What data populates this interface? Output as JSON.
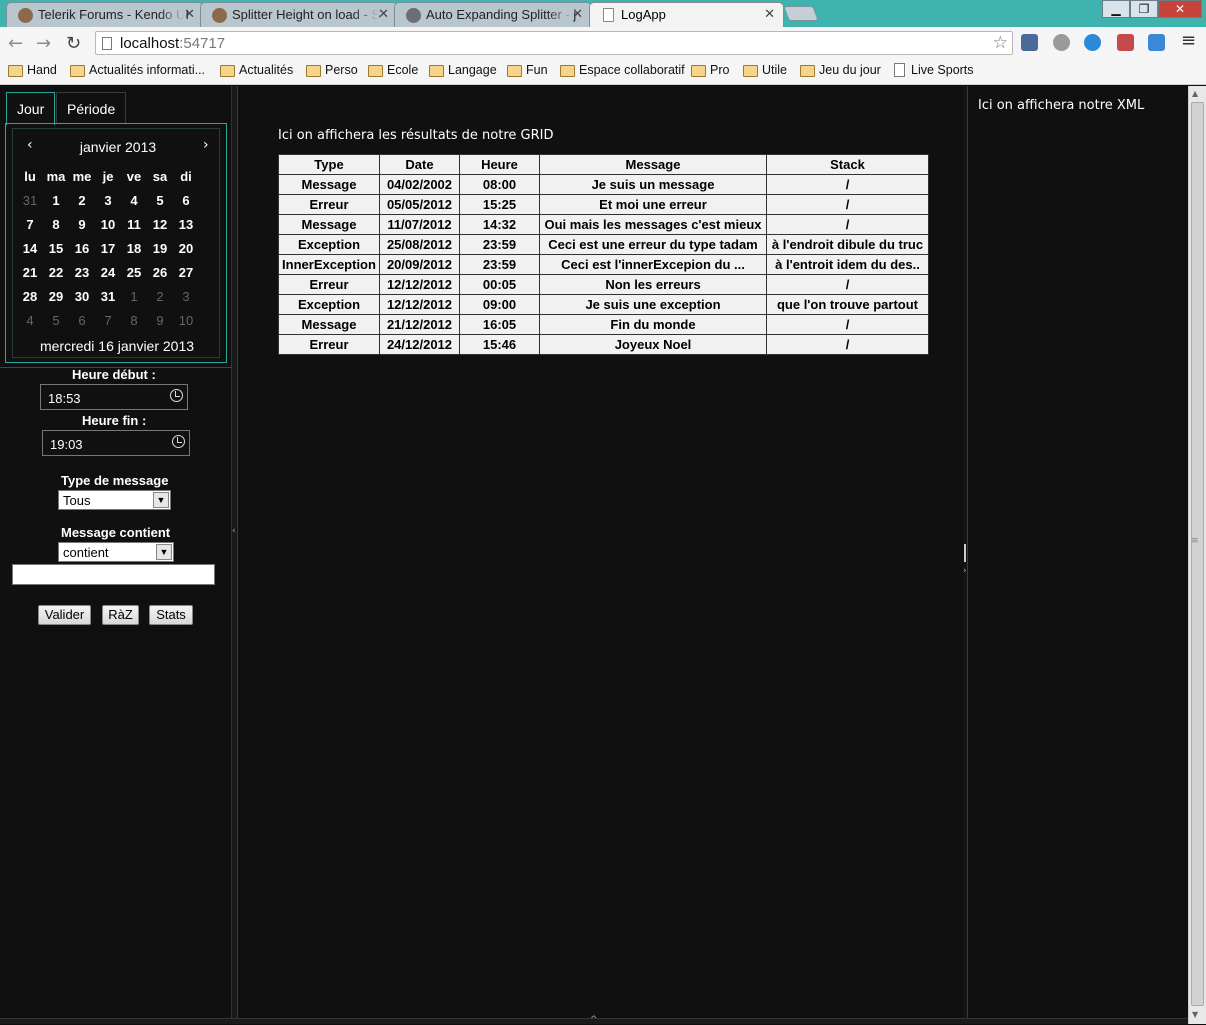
{
  "browser": {
    "tabs": [
      {
        "title": "Telerik Forums - Kendo UI"
      },
      {
        "title": "Splitter Height on load - S"
      },
      {
        "title": "Auto Expanding Splitter - j"
      },
      {
        "title": "LogApp"
      }
    ],
    "url_host": "localhost",
    "url_port": ":54717",
    "bookmarks": [
      "Hand",
      "Actualités informati...",
      "Actualités",
      "Perso",
      "Ecole",
      "Langage",
      "Fun",
      "Espace collaboratif",
      "Pro",
      "Utile",
      "Jeu du jour",
      "Live Sports"
    ]
  },
  "left": {
    "tabs": [
      "Jour",
      "Période"
    ],
    "calendar": {
      "title": "janvier 2013",
      "weekdays": [
        "lu",
        "ma",
        "me",
        "je",
        "ve",
        "sa",
        "di"
      ],
      "weeks": [
        [
          "31",
          "1",
          "2",
          "3",
          "4",
          "5",
          "6"
        ],
        [
          "7",
          "8",
          "9",
          "10",
          "11",
          "12",
          "13"
        ],
        [
          "14",
          "15",
          "16",
          "17",
          "18",
          "19",
          "20"
        ],
        [
          "21",
          "22",
          "23",
          "24",
          "25",
          "26",
          "27"
        ],
        [
          "28",
          "29",
          "30",
          "31",
          "1",
          "2",
          "3"
        ],
        [
          "4",
          "5",
          "6",
          "7",
          "8",
          "9",
          "10"
        ]
      ],
      "footer": "mercredi 16 janvier 2013"
    },
    "start_label": "Heure début :",
    "start_value": "18:53",
    "end_label": "Heure fin :",
    "end_value": "19:03",
    "type_label": "Type de message",
    "type_value": "Tous",
    "contains_label": "Message contient",
    "contains_value": "contient",
    "buttons": [
      "Valider",
      "RàZ",
      "Stats"
    ]
  },
  "center": {
    "title": "Ici on affichera les résultats de notre GRID",
    "columns": [
      "Type",
      "Date",
      "Heure",
      "Message",
      "Stack"
    ],
    "rows": [
      [
        "Message",
        "04/02/2002",
        "08:00",
        "Je suis un message",
        "/"
      ],
      [
        "Erreur",
        "05/05/2012",
        "15:25",
        "Et moi une erreur",
        "/"
      ],
      [
        "Message",
        "11/07/2012",
        "14:32",
        "Oui mais les messages c'est mieux",
        "/"
      ],
      [
        "Exception",
        "25/08/2012",
        "23:59",
        "Ceci est une erreur du type tadam",
        "à l'endroit dibule du truc"
      ],
      [
        "InnerException",
        "20/09/2012",
        "23:59",
        "Ceci est l'innerExcepion du ...",
        "à l'entroit idem du des.."
      ],
      [
        "Erreur",
        "12/12/2012",
        "00:05",
        "Non les erreurs",
        "/"
      ],
      [
        "Exception",
        "12/12/2012",
        "09:00",
        "Je suis une exception",
        "que l'on trouve partout"
      ],
      [
        "Message",
        "21/12/2012",
        "16:05",
        "Fin du monde",
        "/"
      ],
      [
        "Erreur",
        "24/12/2012",
        "15:46",
        "Joyeux Noel",
        "/"
      ]
    ]
  },
  "right": {
    "title": "Ici on affichera notre XML"
  }
}
